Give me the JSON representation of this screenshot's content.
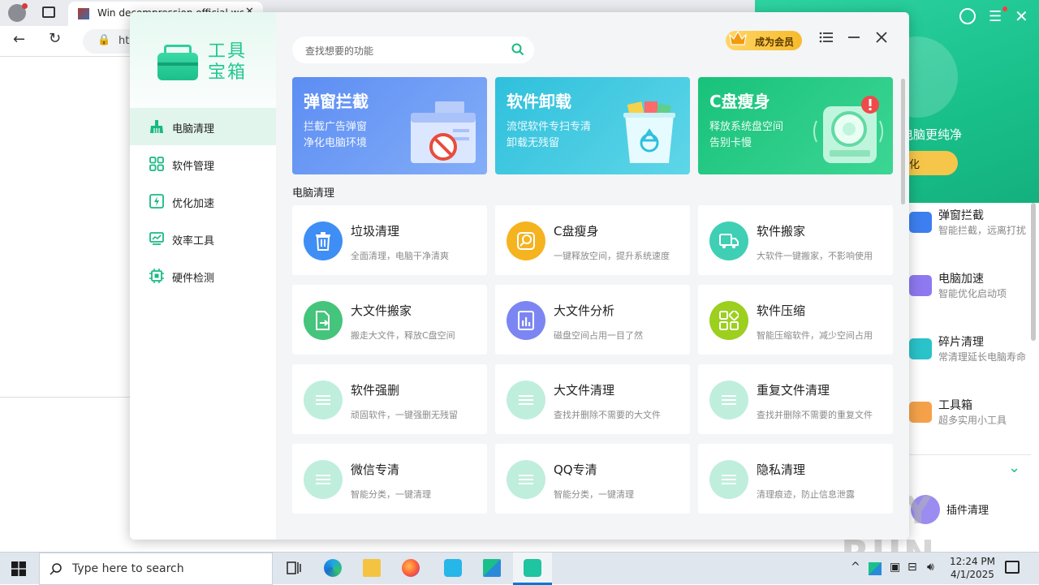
{
  "browser": {
    "tab_title": "Win decompression official web",
    "url": "ht"
  },
  "side_app": {
    "slogan": "电脑更纯净",
    "optimize_button": "化",
    "items": [
      {
        "title": "弹窗拦截",
        "sub": "智能拦截，远离打扰",
        "icon": "ad-block-icon",
        "color": "#3d7ff0"
      },
      {
        "title": "电脑加速",
        "sub": "智能优化启动项",
        "icon": "rocket-icon",
        "color": "#8e79f0"
      },
      {
        "title": "碎片清理",
        "sub": "常清理延长电脑寿命",
        "icon": "disk-icon",
        "color": "#29c3c9"
      },
      {
        "title": "工具箱",
        "sub": "超多实用小工具",
        "icon": "toolbox-icon",
        "color": "#f5a14a"
      }
    ],
    "plugin_label": "插件清理",
    "watermark": "ANY RUN"
  },
  "app": {
    "logo_text": "工具宝箱",
    "search_placeholder": "查找想要的功能",
    "vip_label": "成为会员",
    "nav": [
      {
        "label": "电脑清理",
        "icon": "broom-icon",
        "active": true
      },
      {
        "label": "软件管理",
        "icon": "apps-grid-icon",
        "active": false
      },
      {
        "label": "优化加速",
        "icon": "lightning-icon",
        "active": false
      },
      {
        "label": "效率工具",
        "icon": "chart-icon",
        "active": false
      },
      {
        "label": "硬件检测",
        "icon": "chip-icon",
        "active": false
      }
    ],
    "banners": [
      {
        "title": "弹窗拦截",
        "line1": "拦截广告弹窗",
        "line2": "净化电脑环境",
        "color_from": "#5c8df3",
        "color_to": "#84aef8"
      },
      {
        "title": "软件卸载",
        "line1": "流氓软件专扫专清",
        "line2": "卸载无残留",
        "color_from": "#2fc0dc",
        "color_to": "#5fd6e8"
      },
      {
        "title": "C盘瘦身",
        "line1": "释放系统盘空间",
        "line2": "告别卡慢",
        "color_from": "#18c27a",
        "color_to": "#3dd694"
      }
    ],
    "section_title": "电脑清理",
    "cards": [
      {
        "title": "垃圾清理",
        "sub": "全面清理，电脑干净清爽",
        "icon": "trash-icon",
        "color": "#3e8ef5"
      },
      {
        "title": "C盘瘦身",
        "sub": "一键释放空间，提升系统速度",
        "icon": "disk-search-icon",
        "color": "#f5b31f"
      },
      {
        "title": "软件搬家",
        "sub": "大软件一键搬家，不影响使用",
        "icon": "truck-icon",
        "color": "#3fcfb4"
      },
      {
        "title": "大文件搬家",
        "sub": "搬走大文件，释放C盘空间",
        "icon": "file-move-icon",
        "color": "#45c47c"
      },
      {
        "title": "大文件分析",
        "sub": "磁盘空间占用一目了然",
        "icon": "file-chart-icon",
        "color": "#7c86f2"
      },
      {
        "title": "软件压缩",
        "sub": "智能压缩软件，减少空间占用",
        "icon": "compress-icon",
        "color": "#9ccf1e"
      },
      {
        "title": "软件强删",
        "sub": "顽固软件，一键强删无残留",
        "icon": "list-icon",
        "color": "#bfeedd"
      },
      {
        "title": "大文件清理",
        "sub": "查找并删除不需要的大文件",
        "icon": "list-icon",
        "color": "#bfeedd"
      },
      {
        "title": "重复文件清理",
        "sub": "查找并删除不需要的重复文件",
        "icon": "list-icon",
        "color": "#bfeedd"
      },
      {
        "title": "微信专清",
        "sub": "智能分类，一键清理",
        "icon": "list-icon",
        "color": "#bfeedd"
      },
      {
        "title": "QQ专清",
        "sub": "智能分类，一键清理",
        "icon": "list-icon",
        "color": "#bfeedd"
      },
      {
        "title": "隐私清理",
        "sub": "清理痕迹，防止信息泄露",
        "icon": "list-icon",
        "color": "#bfeedd"
      }
    ]
  },
  "taskbar": {
    "search_placeholder": "Type here to search",
    "time": "12:24 PM",
    "date": "4/1/2025"
  }
}
